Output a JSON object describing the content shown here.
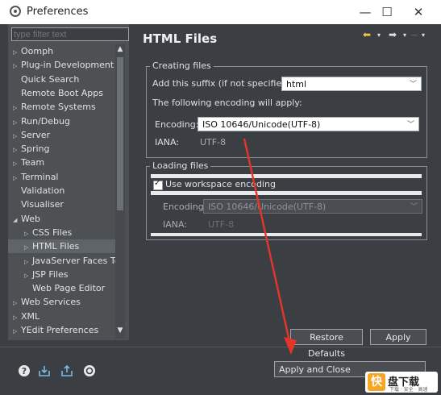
{
  "window": {
    "title": "Preferences",
    "minimize": "—",
    "maximize": "☐",
    "close": "✕"
  },
  "filter": {
    "placeholder": "type filter text"
  },
  "tree": [
    {
      "label": "Oomph",
      "chev": "▷",
      "indent": 0
    },
    {
      "label": "Plug-in Development",
      "chev": "▷",
      "indent": 0
    },
    {
      "label": "Quick Search",
      "chev": "",
      "indent": 0
    },
    {
      "label": "Remote Boot Apps",
      "chev": "",
      "indent": 0
    },
    {
      "label": "Remote Systems",
      "chev": "▷",
      "indent": 0
    },
    {
      "label": "Run/Debug",
      "chev": "▷",
      "indent": 0
    },
    {
      "label": "Server",
      "chev": "▷",
      "indent": 0
    },
    {
      "label": "Spring",
      "chev": "▷",
      "indent": 0
    },
    {
      "label": "Team",
      "chev": "▷",
      "indent": 0
    },
    {
      "label": "Terminal",
      "chev": "▷",
      "indent": 0
    },
    {
      "label": "Validation",
      "chev": "",
      "indent": 0
    },
    {
      "label": "Visualiser",
      "chev": "",
      "indent": 0
    },
    {
      "label": "Web",
      "chev": "◢",
      "indent": 0
    },
    {
      "label": "CSS Files",
      "chev": "▷",
      "indent": 1
    },
    {
      "label": "HTML Files",
      "chev": "▷",
      "indent": 1,
      "selected": true
    },
    {
      "label": "JavaServer Faces Tools",
      "chev": "▷",
      "indent": 1
    },
    {
      "label": "JSP Files",
      "chev": "▷",
      "indent": 1
    },
    {
      "label": "Web Page Editor",
      "chev": "",
      "indent": 1
    },
    {
      "label": "Web Services",
      "chev": "▷",
      "indent": 0
    },
    {
      "label": "XML",
      "chev": "▷",
      "indent": 0
    },
    {
      "label": "YEdit Preferences",
      "chev": "▷",
      "indent": 0
    }
  ],
  "page": {
    "title": "HTML Files"
  },
  "creating": {
    "legend": "Creating files",
    "suffix_label": "Add this suffix (if not specified):",
    "suffix_value": "html",
    "encoding_note": "The following encoding will apply:",
    "encoding_label": "Encoding:",
    "encoding_value": "ISO 10646/Unicode(UTF-8)",
    "iana_label": "IANA:",
    "iana_value": "UTF-8"
  },
  "loading": {
    "legend": "Loading files",
    "workspace_label": "Use workspace encoding",
    "workspace_checked": true,
    "encoding_label": "Encoding:",
    "encoding_value": "ISO 10646/Unicode(UTF-8)",
    "iana_label": "IANA:",
    "iana_value": "UTF-8"
  },
  "buttons": {
    "restore": "Restore Defaults",
    "apply": "Apply",
    "apply_close": "Apply and Close"
  },
  "watermark": {
    "logo": "快",
    "text": "盘下载",
    "sub": "下载 · 安全 · 高速"
  },
  "colors": {
    "arrow": "#e5352b",
    "panel": "#3b3f43",
    "selected": "#5f6468"
  }
}
